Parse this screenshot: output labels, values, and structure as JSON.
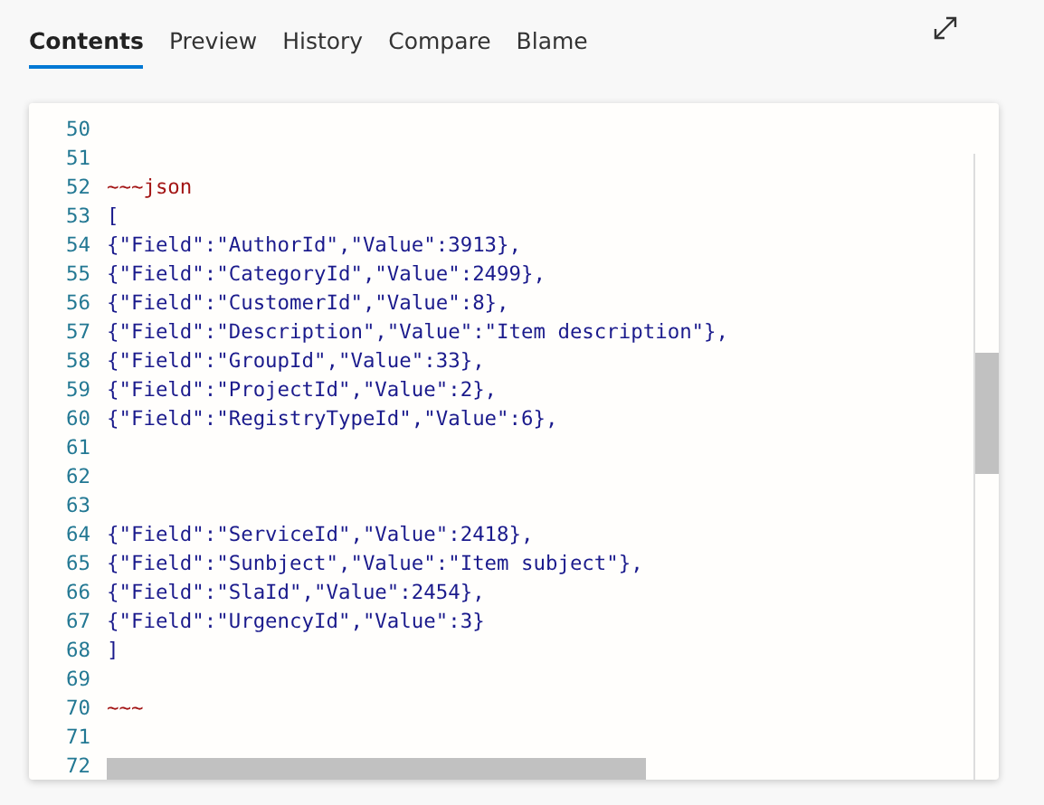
{
  "tabs": [
    {
      "label": "Contents",
      "selected": true
    },
    {
      "label": "Preview",
      "selected": false
    },
    {
      "label": "History",
      "selected": false
    },
    {
      "label": "Compare",
      "selected": false
    },
    {
      "label": "Blame",
      "selected": false
    }
  ],
  "editor": {
    "lines": [
      {
        "number": "50"
      },
      {
        "number": "51"
      },
      {
        "number": "52",
        "kind": "fence",
        "text": "~~~json"
      },
      {
        "number": "53",
        "kind": "code",
        "text": "["
      },
      {
        "number": "54",
        "kind": "code",
        "text": "{\"Field\":\"AuthorId\",\"Value\":3913},"
      },
      {
        "number": "55",
        "kind": "code",
        "text": "{\"Field\":\"CategoryId\",\"Value\":2499},"
      },
      {
        "number": "56",
        "kind": "code",
        "text": "{\"Field\":\"CustomerId\",\"Value\":8},"
      },
      {
        "number": "57",
        "kind": "code",
        "text": "{\"Field\":\"Description\",\"Value\":\"Item description\"},"
      },
      {
        "number": "58",
        "kind": "code",
        "text": "{\"Field\":\"GroupId\",\"Value\":33},"
      },
      {
        "number": "59",
        "kind": "code",
        "text": "{\"Field\":\"ProjectId\",\"Value\":2},"
      },
      {
        "number": "60",
        "kind": "code",
        "text": "{\"Field\":\"RegistryTypeId\",\"Value\":6},"
      },
      {
        "number": "61"
      },
      {
        "number": "62"
      },
      {
        "number": "63"
      },
      {
        "number": "64",
        "kind": "code",
        "text": "{\"Field\":\"ServiceId\",\"Value\":2418},"
      },
      {
        "number": "65",
        "kind": "code",
        "text": "{\"Field\":\"Sunbject\",\"Value\":\"Item subject\"},"
      },
      {
        "number": "66",
        "kind": "code",
        "text": "{\"Field\":\"SlaId\",\"Value\":2454},"
      },
      {
        "number": "67",
        "kind": "code",
        "text": "{\"Field\":\"UrgencyId\",\"Value\":3}"
      },
      {
        "number": "68",
        "kind": "code",
        "text": "]"
      },
      {
        "number": "69"
      },
      {
        "number": "70",
        "kind": "fence",
        "text": "~~~"
      },
      {
        "number": "71"
      },
      {
        "number": "72"
      }
    ]
  }
}
